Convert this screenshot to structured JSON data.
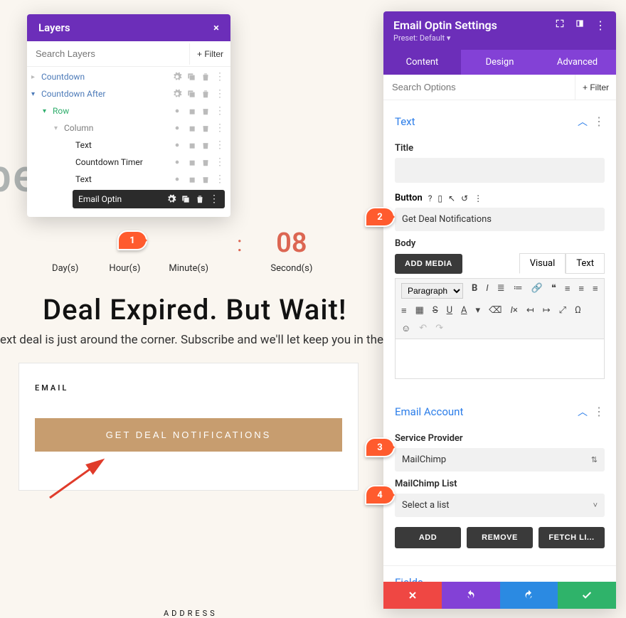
{
  "layers": {
    "title": "Layers",
    "search_placeholder": "Search Layers",
    "filter_label": "+ Filter",
    "items": {
      "countdown": "Countdown",
      "countdown_after": "Countdown After",
      "row": "Row",
      "column": "Column",
      "text1": "Text",
      "timer": "Countdown Timer",
      "text2": "Text",
      "email_optin": "Email Optin"
    }
  },
  "background": {
    "wide_text": "bershi",
    "timer": {
      "seconds_num": "08",
      "days": "Day(s)",
      "hours": "Hour(s)",
      "minutes": "Minute(s)",
      "seconds": "Second(s)"
    },
    "headline": "Deal Expired. But Wait!",
    "subline": "ext deal is just around the corner. Subscribe and we'll let keep you in the",
    "email_label": "EMAIL",
    "cta": "GET DEAL NOTIFICATIONS",
    "address": "ADDRESS"
  },
  "badges": {
    "b1": "1",
    "b2": "2",
    "b3": "3",
    "b4": "4"
  },
  "settings": {
    "title": "Email Optin Settings",
    "preset": "Preset: Default ",
    "tabs": {
      "content": "Content",
      "design": "Design",
      "advanced": "Advanced"
    },
    "search_placeholder": "Search Options",
    "filter_label": "+ Filter",
    "text_section": "Text",
    "title_label": "Title",
    "button_label": "Button",
    "button_value": "Get Deal Notifications",
    "body_label": "Body",
    "add_media": "ADD MEDIA",
    "mode_visual": "Visual",
    "mode_text": "Text",
    "paragraph": "Paragraph",
    "email_account_section": "Email Account",
    "service_provider_label": "Service Provider",
    "service_provider_value": "MailChimp",
    "list_label": "MailChimp List",
    "list_value": "Select a list",
    "btn_add": "ADD",
    "btn_remove": "REMOVE",
    "btn_fetch": "FETCH LI...",
    "fields_section": "Fields"
  }
}
